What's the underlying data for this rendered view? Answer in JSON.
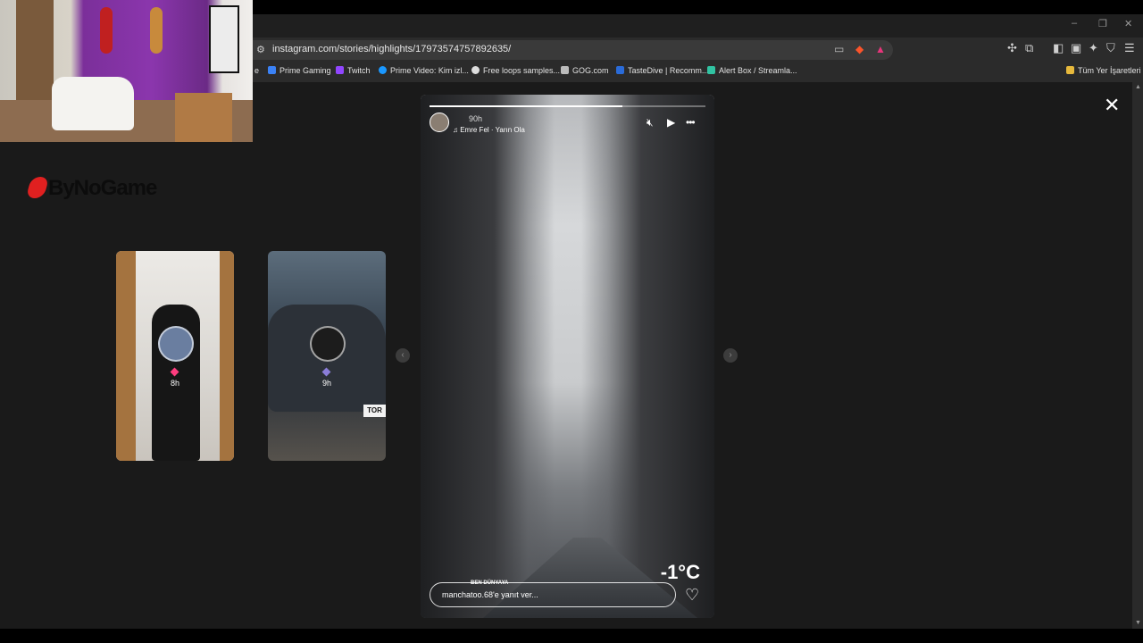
{
  "browser": {
    "url": "instagram.com/stories/highlights/17973574757892635/",
    "window_controls": [
      "–",
      "❐",
      "✕"
    ]
  },
  "bookmarks": {
    "items": [
      {
        "label": "e",
        "color": "#7aa7ff"
      },
      {
        "label": "Prime Gaming",
        "color": "#3b82f6"
      },
      {
        "label": "Twitch",
        "color": "#9146ff"
      },
      {
        "label": "Prime Video: Kim izl...",
        "color": "#1a98ff"
      },
      {
        "label": "Free loops samples...",
        "color": "#dddddd"
      },
      {
        "label": "GOG.com",
        "color": "#bbbbbb"
      },
      {
        "label": "TasteDive | Recomm...",
        "color": "#2a6bd8"
      },
      {
        "label": "Alert Box / Streamla...",
        "color": "#31c3a2"
      }
    ],
    "folder": "Tüm Yer İşaretleri"
  },
  "logo": {
    "text": "ByNoGame"
  },
  "side_stories": [
    {
      "time": "8h",
      "gem_color": "#ff3d7f"
    },
    {
      "time": "9h",
      "gem_color": "#8a7dd8",
      "plate": "TOR"
    }
  ],
  "story": {
    "progress": 0.7,
    "username": "",
    "time": "90h",
    "music": "♫ Emre Fel · Yarın Ola",
    "temperature": "-1°C",
    "caption_small": "BEN DÜNYAYA",
    "reply_placeholder": "manchatoo.68'e yanıt ver..."
  },
  "icons": {
    "close": "✕",
    "mute": "🔇",
    "play": "▶",
    "more": "•••",
    "heart": "♡",
    "prev": "‹",
    "next": "›"
  }
}
